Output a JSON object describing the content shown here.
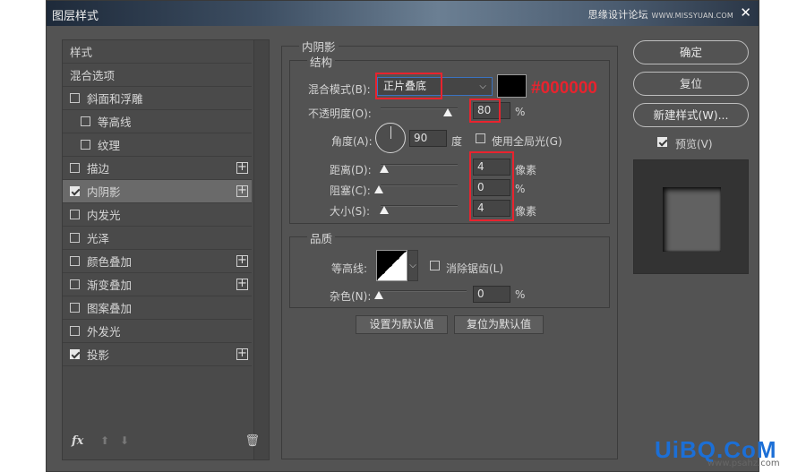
{
  "window": {
    "title": "图层样式",
    "brand": "思缘设计论坛",
    "brand_url": "WWW.MISSYUAN.COM",
    "close_glyph": "✕"
  },
  "left_panel": {
    "items": [
      {
        "label": "样式",
        "checkbox": false,
        "checked": false,
        "plus": false,
        "indent": 0
      },
      {
        "label": "混合选项",
        "checkbox": false,
        "checked": false,
        "plus": false,
        "indent": 0
      },
      {
        "label": "斜面和浮雕",
        "checkbox": true,
        "checked": false,
        "plus": false,
        "indent": 0
      },
      {
        "label": "等高线",
        "checkbox": true,
        "checked": false,
        "plus": false,
        "indent": 1
      },
      {
        "label": "纹理",
        "checkbox": true,
        "checked": false,
        "plus": false,
        "indent": 1
      },
      {
        "label": "描边",
        "checkbox": true,
        "checked": false,
        "plus": true,
        "indent": 0
      },
      {
        "label": "内阴影",
        "checkbox": true,
        "checked": true,
        "plus": true,
        "indent": 0,
        "selected": true
      },
      {
        "label": "内发光",
        "checkbox": true,
        "checked": false,
        "plus": false,
        "indent": 0
      },
      {
        "label": "光泽",
        "checkbox": true,
        "checked": false,
        "plus": false,
        "indent": 0
      },
      {
        "label": "颜色叠加",
        "checkbox": true,
        "checked": false,
        "plus": true,
        "indent": 0
      },
      {
        "label": "渐变叠加",
        "checkbox": true,
        "checked": false,
        "plus": true,
        "indent": 0
      },
      {
        "label": "图案叠加",
        "checkbox": true,
        "checked": false,
        "plus": false,
        "indent": 0
      },
      {
        "label": "外发光",
        "checkbox": true,
        "checked": false,
        "plus": false,
        "indent": 0
      },
      {
        "label": "投影",
        "checkbox": true,
        "checked": true,
        "plus": true,
        "indent": 0
      }
    ],
    "footer": {
      "fx": "fx",
      "up_glyph": "⬆",
      "down_glyph": "⬇",
      "trash_glyph": "🗑"
    }
  },
  "inner_shadow": {
    "section_title": "内阴影",
    "structure": {
      "title": "结构",
      "blend_mode_label": "混合模式(B):",
      "blend_mode_value": "正片叠底",
      "color_hex_annotation": "#000000",
      "opacity_label": "不透明度(O):",
      "opacity_value": "80",
      "opacity_unit": "%",
      "angle_label": "角度(A):",
      "angle_value": "90",
      "angle_unit": "度",
      "global_light_label": "使用全局光(G)",
      "global_light_checked": false,
      "distance_label": "距离(D):",
      "distance_value": "4",
      "distance_unit": "像素",
      "choke_label": "阻塞(C):",
      "choke_value": "0",
      "choke_unit": "%",
      "size_label": "大小(S):",
      "size_value": "4",
      "size_unit": "像素"
    },
    "quality": {
      "title": "品质",
      "contour_label": "等高线:",
      "anti_alias_label": "消除锯齿(L)",
      "anti_alias_checked": false,
      "noise_label": "杂色(N):",
      "noise_value": "0",
      "noise_unit": "%"
    },
    "make_default": "设置为默认值",
    "reset_default": "复位为默认值"
  },
  "right_buttons": {
    "ok": "确定",
    "reset": "复位",
    "new_style": "新建样式(W)...",
    "preview_label": "预览(V)",
    "preview_checked": true
  },
  "watermark": {
    "text": "UiBQ.CoM",
    "sub": "www.psahz.com"
  }
}
